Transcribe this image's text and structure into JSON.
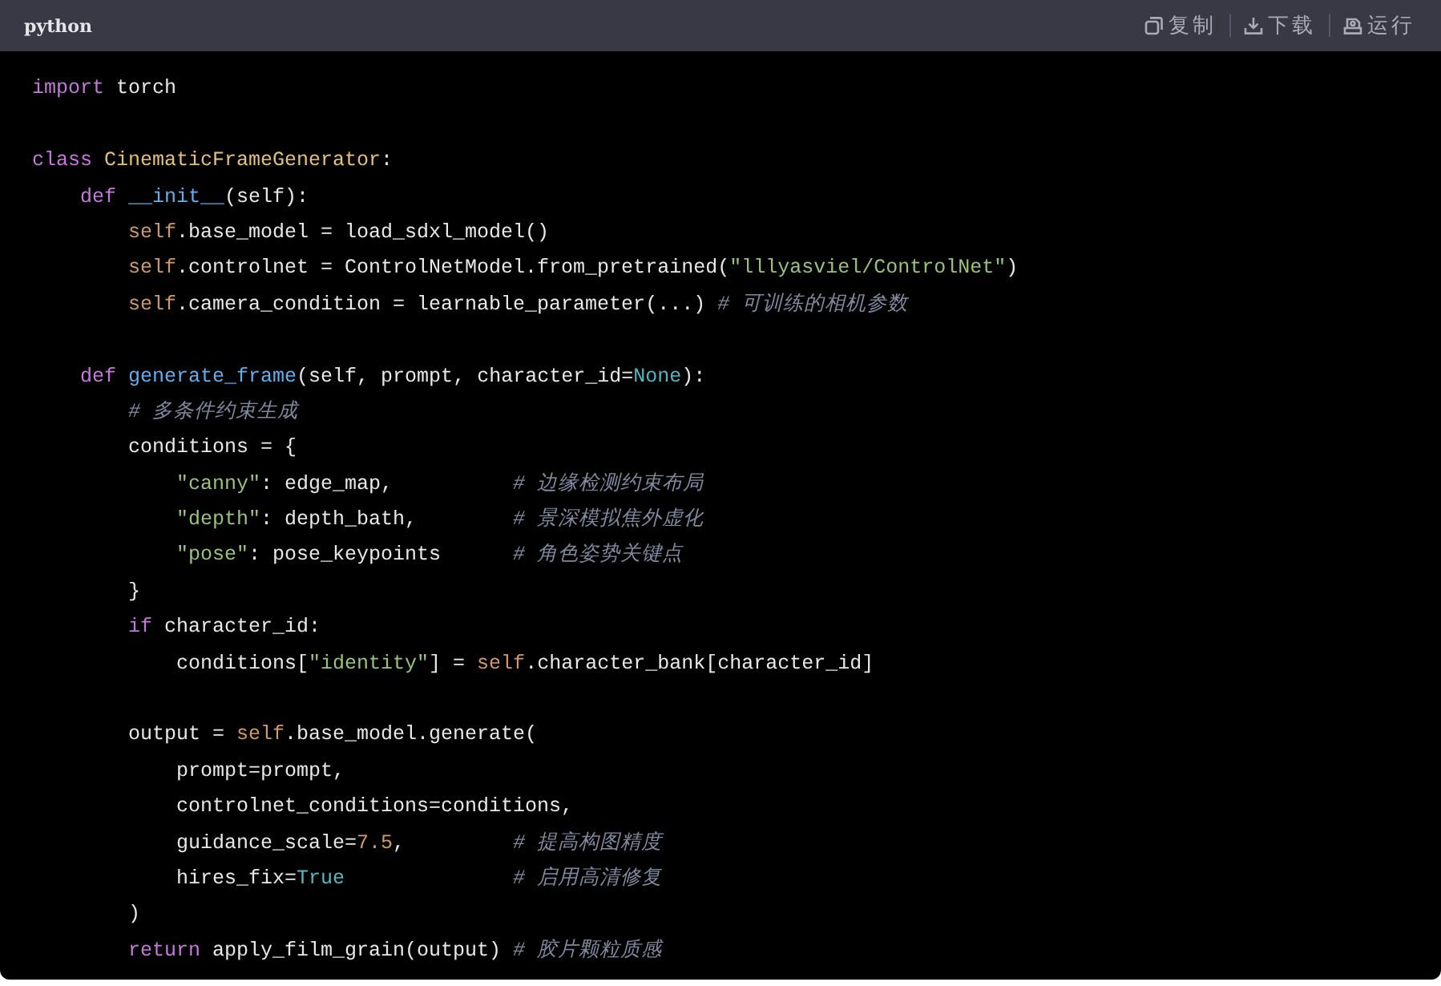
{
  "header": {
    "language": "python",
    "actions": [
      {
        "kind": "copy",
        "label": "复制"
      },
      {
        "kind": "download",
        "label": "下载"
      },
      {
        "kind": "run",
        "label": "运行"
      }
    ]
  },
  "code": {
    "lines": [
      {
        "kind": "blank"
      },
      {
        "kind": "code",
        "tokens": [
          {
            "kind": "kw",
            "text": "import "
          },
          {
            "kind": "plain",
            "text": "torch"
          }
        ]
      },
      {
        "kind": "blank"
      },
      {
        "kind": "code",
        "tokens": [
          {
            "kind": "kw",
            "text": "class "
          },
          {
            "kind": "cls",
            "text": "CinematicFrameGenerator"
          },
          {
            "kind": "plain",
            "text": ":"
          }
        ],
        "children": [
          {
            "kind": "code",
            "tokens": [
              {
                "kind": "kw",
                "text": "def "
              },
              {
                "kind": "fn",
                "text": "__init__"
              },
              {
                "kind": "plain",
                "text": "(self):"
              }
            ],
            "children": [
              {
                "kind": "code",
                "tokens": [
                  {
                    "kind": "self",
                    "text": "self"
                  },
                  {
                    "kind": "plain",
                    "text": ".base_model = load_sdxl_model()"
                  }
                ]
              },
              {
                "kind": "code",
                "tokens": [
                  {
                    "kind": "self",
                    "text": "self"
                  },
                  {
                    "kind": "plain",
                    "text": ".controlnet = ControlNetModel.from_pretrained("
                  },
                  {
                    "kind": "str",
                    "text": "\"lllyasviel/ControlNet\""
                  },
                  {
                    "kind": "plain",
                    "text": ")"
                  }
                ]
              },
              {
                "kind": "code",
                "tokens": [
                  {
                    "kind": "self",
                    "text": "self"
                  },
                  {
                    "kind": "plain",
                    "text": ".camera_condition = learnable_parameter(...) "
                  },
                  {
                    "kind": "cmt",
                    "text": "# 可训练的相机参数"
                  }
                ]
              }
            ]
          },
          {
            "kind": "blank"
          },
          {
            "kind": "code",
            "tokens": [
              {
                "kind": "kw",
                "text": "def "
              },
              {
                "kind": "fn",
                "text": "generate_frame"
              },
              {
                "kind": "plain",
                "text": "(self, prompt, character_id="
              },
              {
                "kind": "const",
                "text": "None"
              },
              {
                "kind": "plain",
                "text": "):"
              }
            ],
            "children": [
              {
                "kind": "code",
                "tokens": [
                  {
                    "kind": "cmt",
                    "text": "# 多条件约束生成"
                  }
                ]
              },
              {
                "kind": "code",
                "tokens": [
                  {
                    "kind": "plain",
                    "text": "conditions = {"
                  }
                ],
                "children": [
                  {
                    "kind": "code",
                    "tokens": [
                      {
                        "kind": "str",
                        "text": "\"canny\""
                      },
                      {
                        "kind": "plain",
                        "text": ": edge_map,          "
                      },
                      {
                        "kind": "cmt",
                        "text": "# 边缘检测约束布局"
                      }
                    ]
                  },
                  {
                    "kind": "code",
                    "tokens": [
                      {
                        "kind": "str",
                        "text": "\"depth\""
                      },
                      {
                        "kind": "plain",
                        "text": ": depth_bath,        "
                      },
                      {
                        "kind": "cmt",
                        "text": "# 景深模拟焦外虚化"
                      }
                    ]
                  },
                  {
                    "kind": "code",
                    "tokens": [
                      {
                        "kind": "str",
                        "text": "\"pose\""
                      },
                      {
                        "kind": "plain",
                        "text": ": pose_keypoints      "
                      },
                      {
                        "kind": "cmt",
                        "text": "# 角色姿势关键点"
                      }
                    ]
                  }
                ]
              },
              {
                "kind": "code",
                "tokens": [
                  {
                    "kind": "plain",
                    "text": "}"
                  }
                ]
              },
              {
                "kind": "code",
                "tokens": [
                  {
                    "kind": "kw",
                    "text": "if "
                  },
                  {
                    "kind": "plain",
                    "text": "character_id:"
                  }
                ],
                "children": [
                  {
                    "kind": "code",
                    "tokens": [
                      {
                        "kind": "plain",
                        "text": "conditions["
                      },
                      {
                        "kind": "str",
                        "text": "\"identity\""
                      },
                      {
                        "kind": "plain",
                        "text": "] = "
                      },
                      {
                        "kind": "self",
                        "text": "self"
                      },
                      {
                        "kind": "plain",
                        "text": ".character_bank[character_id]"
                      }
                    ]
                  }
                ]
              },
              {
                "kind": "blank"
              },
              {
                "kind": "code",
                "tokens": [
                  {
                    "kind": "plain",
                    "text": "output = "
                  },
                  {
                    "kind": "self",
                    "text": "self"
                  },
                  {
                    "kind": "plain",
                    "text": ".base_model.generate("
                  }
                ],
                "children": [
                  {
                    "kind": "code",
                    "tokens": [
                      {
                        "kind": "plain",
                        "text": "prompt=prompt,"
                      }
                    ]
                  },
                  {
                    "kind": "code",
                    "tokens": [
                      {
                        "kind": "plain",
                        "text": "controlnet_conditions=conditions,"
                      }
                    ]
                  },
                  {
                    "kind": "code",
                    "tokens": [
                      {
                        "kind": "plain",
                        "text": "guidance_scale="
                      },
                      {
                        "kind": "num",
                        "text": "7.5"
                      },
                      {
                        "kind": "plain",
                        "text": ",         "
                      },
                      {
                        "kind": "cmt",
                        "text": "# 提高构图精度"
                      }
                    ]
                  },
                  {
                    "kind": "code",
                    "tokens": [
                      {
                        "kind": "plain",
                        "text": "hires_fix="
                      },
                      {
                        "kind": "const",
                        "text": "True"
                      },
                      {
                        "kind": "cmt",
                        "text": "              # 启用高清修复"
                      }
                    ]
                  }
                ]
              },
              {
                "kind": "code",
                "tokens": [
                  {
                    "kind": "plain",
                    "text": ")"
                  }
                ]
              },
              {
                "kind": "code",
                "tokens": [
                  {
                    "kind": "kw",
                    "text": "return "
                  },
                  {
                    "kind": "plain",
                    "text": "apply_film_grain(output) "
                  },
                  {
                    "kind": "cmt",
                    "text": "# 胶片颗粒质感"
                  }
                ]
              }
            ]
          }
        ]
      }
    ]
  }
}
